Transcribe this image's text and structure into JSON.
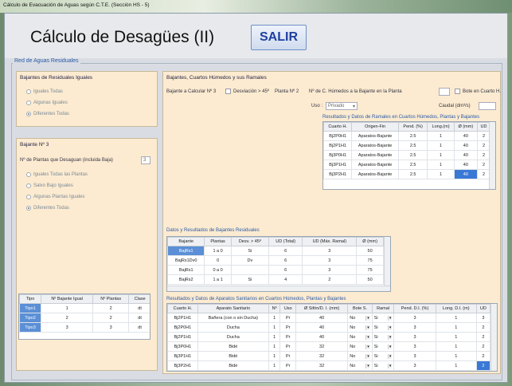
{
  "window": {
    "title": "Cálculo de Evacuación de Aguas según C.T.E. (Sección HS - 5)"
  },
  "header": {
    "title": "Cálculo de Desagües (II)",
    "exit_label": "SALIR"
  },
  "main": {
    "group_label": "Red de Aguas Residuales"
  },
  "bajantes_iguales": {
    "title": "Bajantes de Residuales Iguales",
    "options": [
      "Iguales Todas",
      "Algunas Iguales",
      "Diferentes Todas"
    ],
    "selected_index": 2
  },
  "bajante_panel": {
    "title": "Bajante Nº 3",
    "plantas_label": "Nº de Plantas que Desaguan (incluida Baja)",
    "plantas_value": "3",
    "options": [
      "Iguales Todas las Plantas",
      "Salvo Bajo Iguales",
      "Algunas Plantas Iguales",
      "Diferentes Todas"
    ],
    "selected_index": 3
  },
  "tipos_table": {
    "headers": [
      "Tipo",
      "Nº Bajante Igual",
      "Nº Plantas",
      "Clase"
    ],
    "rows": [
      [
        "Tipo1",
        "1",
        "2",
        "dt"
      ],
      [
        "Tipo2",
        "2",
        "2",
        "dt"
      ],
      [
        "Tipo3",
        "3",
        "3",
        "dt"
      ]
    ]
  },
  "ramales_panel": {
    "title": "Bajantes, Cuartos Húmedos y sus Ramales",
    "bajante_calc_label": "Bajante a Calcular Nº 3",
    "desviacion_label": "Desviación > 45º",
    "planta_label": "Planta Nº 2",
    "c_humedos_label": "Nº de C. Húmedos a la Bajante en la Planta",
    "bote_label": "Bote en Cuarto H.",
    "uso_label": "Uso :",
    "uso_value": "Privado",
    "caudal_label": "Caudal (dm³/s)"
  },
  "ramales_table": {
    "title": "Resultados y Datos de Ramales en Cuartos Húmedos, Plantas y Bajantes",
    "headers": [
      "Cuarto H.",
      "Origen-Fin",
      "Pend. (%)",
      "Long.(m)",
      "Ø (mm)",
      "UD"
    ],
    "rows": [
      [
        "Bj2P0H1",
        "Aparatos-Bajante",
        "2.5",
        "1",
        "40",
        "2"
      ],
      [
        "Bj2P1H1",
        "Aparatos-Bajante",
        "2.5",
        "1",
        "40",
        "2"
      ],
      [
        "Bj3P0H1",
        "Aparatos-Bajante",
        "2.5",
        "1",
        "40",
        "2"
      ],
      [
        "Bj3P1H1",
        "Aparatos-Bajante",
        "2.5",
        "1",
        "40",
        "2"
      ],
      [
        "Bj3P2H1",
        "Aparatos-Bajante",
        "2.5",
        "1",
        "40",
        "2"
      ]
    ]
  },
  "bajantes_table": {
    "title": "Datos y Resultados de Bajantes Residuales",
    "headers": [
      "Bajante",
      "Plantas",
      "Desv. > 45º",
      "UD (Total)",
      "UD (Máx. Ramal)",
      "Ø (mm)"
    ],
    "rows": [
      [
        "BajRs1",
        "1 a 0",
        "Si",
        "6",
        "3",
        "50"
      ],
      [
        "BajRs1Dv0",
        "0",
        "Dv",
        "6",
        "3",
        "75"
      ],
      [
        "BajRs1",
        "0 a 0",
        "",
        "6",
        "3",
        "75"
      ],
      [
        "BajRs2",
        "1 a 1",
        "Si",
        "4",
        "2",
        "50"
      ]
    ]
  },
  "aparatos_table": {
    "title": "Resultados y Datos de Aparatos Sanitarios en Cuartos Húmedos, Plantas y Bajantes",
    "headers": [
      "Cuarto H.",
      "Aparato Sanitario",
      "Nº",
      "Uso",
      "Ø Sifón/D. I. (mm)",
      "Bote S.",
      "Ramal",
      "Pend. D.I. (%)",
      "Long. D.I. (m)",
      "UD"
    ],
    "rows": [
      [
        "Bj2P1H1",
        "Bañera (con o sin Ducha)",
        "1",
        "Pr",
        "40",
        "No",
        "Si",
        "3",
        "1",
        "3"
      ],
      [
        "Bj2P0H1",
        "Ducha",
        "1",
        "Pr",
        "40",
        "No",
        "Si",
        "3",
        "1",
        "2"
      ],
      [
        "Bj2P1H1",
        "Ducha",
        "1",
        "Pr",
        "40",
        "No",
        "Si",
        "3",
        "1",
        "2"
      ],
      [
        "Bj3P0H1",
        "Bidé",
        "1",
        "Pr",
        "32",
        "No",
        "Si",
        "3",
        "1",
        "2"
      ],
      [
        "Bj3P1H1",
        "Bidé",
        "1",
        "Pr",
        "32",
        "No",
        "Si",
        "3",
        "1",
        "2"
      ],
      [
        "Bj3P2H1",
        "Bidé",
        "1",
        "Pr",
        "32",
        "No",
        "Si",
        "3",
        "1",
        "2"
      ]
    ]
  }
}
